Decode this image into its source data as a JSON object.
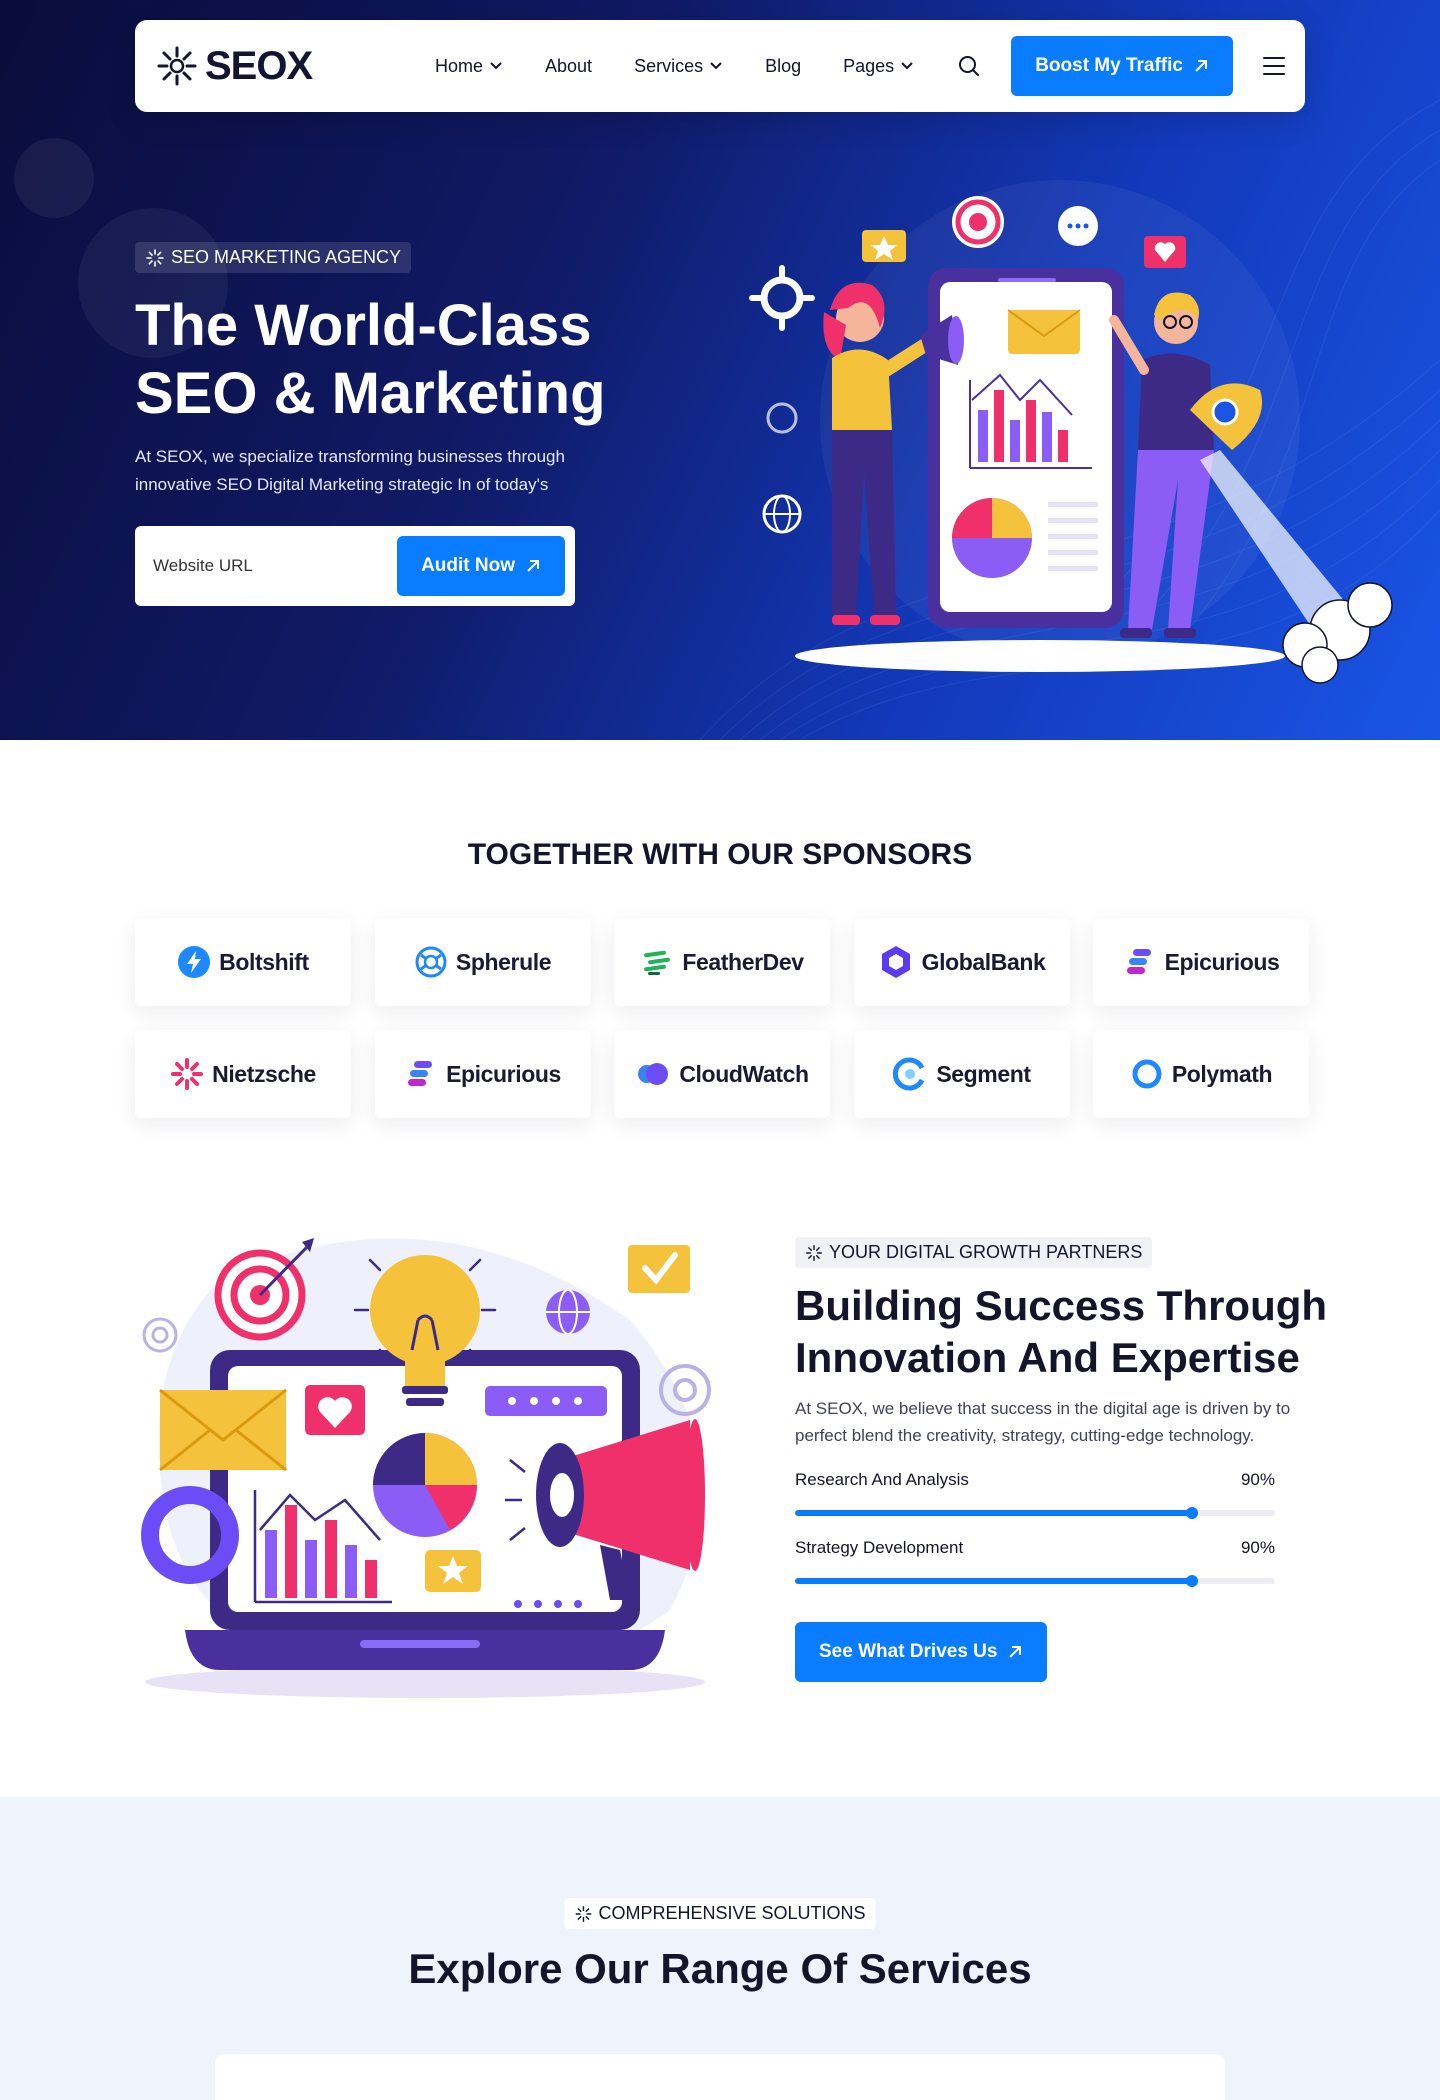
{
  "colors": {
    "accent": "#0a7cff",
    "hero_dark": "#0a0c3a",
    "hero_blue": "#1a55e6",
    "text_dark": "#14142b",
    "services_bg": "#eef3fc"
  },
  "nav": {
    "logo": "SEOX",
    "items": [
      "Home",
      "About",
      "Services",
      "Blog",
      "Pages"
    ],
    "search_icon": "search-icon",
    "cta": "Boost My Traffic"
  },
  "hero": {
    "badge": "SEO MARKETING AGENCY",
    "title_line1": "The World-Class",
    "title_line2": "SEO & Marketing",
    "subtitle": "At SEOX, we specialize transforming businesses through innovative SEO Digital Marketing strategic In of today's",
    "url_placeholder": "Website URL",
    "audit_button": "Audit Now"
  },
  "sponsors": {
    "title": "TOGETHER WITH OUR SPONSORS",
    "items": [
      {
        "name": "Boltshift",
        "icon": "bolt-icon",
        "color": "#1e88ff"
      },
      {
        "name": "Spherule",
        "icon": "sphere-icon",
        "color": "#1e88ff"
      },
      {
        "name": "FeatherDev",
        "icon": "feather-icon",
        "color": "#22b35a"
      },
      {
        "name": "GlobalBank",
        "icon": "hexagon-icon",
        "color": "#5b3bf0"
      },
      {
        "name": "Epicurious",
        "icon": "stripes-icon",
        "color": "#6b4cf6"
      },
      {
        "name": "Nietzsche",
        "icon": "burst-icon",
        "color": "#f0306a"
      },
      {
        "name": "Epicurious",
        "icon": "stripes-icon",
        "color": "#6b4cf6"
      },
      {
        "name": "CloudWatch",
        "icon": "cloud-icon",
        "color": "#6b4cf6"
      },
      {
        "name": "Segment",
        "icon": "segment-icon",
        "color": "#1e88ff"
      },
      {
        "name": "Polymath",
        "icon": "ring-icon",
        "color": "#1e88ff"
      }
    ]
  },
  "growth": {
    "badge": "YOUR DIGITAL GROWTH PARTNERS",
    "title_line1": "Building Success Through",
    "title_line2": "Innovation And Expertise",
    "text": "At SEOX, we believe that success in the digital age is driven by to perfect blend the  creativity, strategy, cutting-edge technology.",
    "skills": [
      {
        "label": "Research And Analysis",
        "value_text": "90%",
        "value": 0.83
      },
      {
        "label": "Strategy Development",
        "value_text": "90%",
        "value": 0.83
      }
    ],
    "cta": "See What Drives Us"
  },
  "services": {
    "badge": "COMPREHENSIVE SOLUTIONS",
    "title": "Explore Our Range Of Services"
  }
}
